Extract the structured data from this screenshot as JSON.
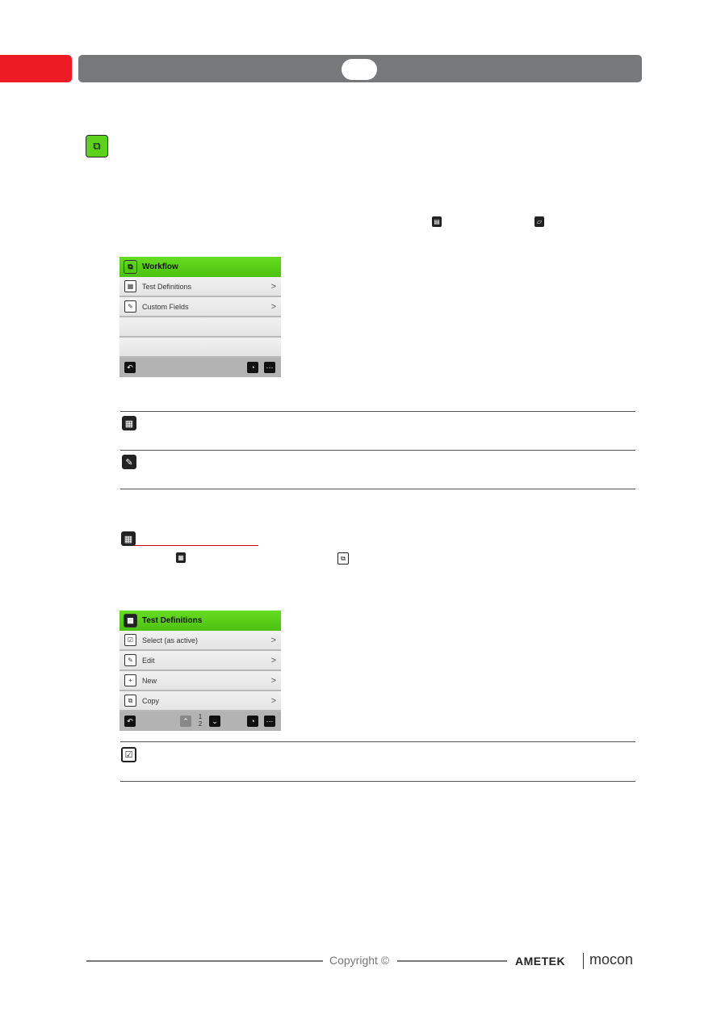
{
  "header": {
    "accent_color": "#ed1c24",
    "bar_color": "#777879"
  },
  "workflow_screen": {
    "title": "Workflow",
    "items": [
      {
        "label": "Test Definitions",
        "icon": "chart-icon"
      },
      {
        "label": "Custom Fields",
        "icon": "edit-form-icon"
      }
    ]
  },
  "test_definitions_screen": {
    "title": "Test Definitions",
    "items": [
      {
        "label": "Select (as active)"
      },
      {
        "label": "Edit"
      },
      {
        "label": "New"
      },
      {
        "label": "Copy"
      }
    ],
    "page_current": "1",
    "page_total": "2"
  },
  "footer": {
    "copyright": "Copyright ©",
    "brand1": "AMETEK",
    "brand2": "mocon"
  }
}
